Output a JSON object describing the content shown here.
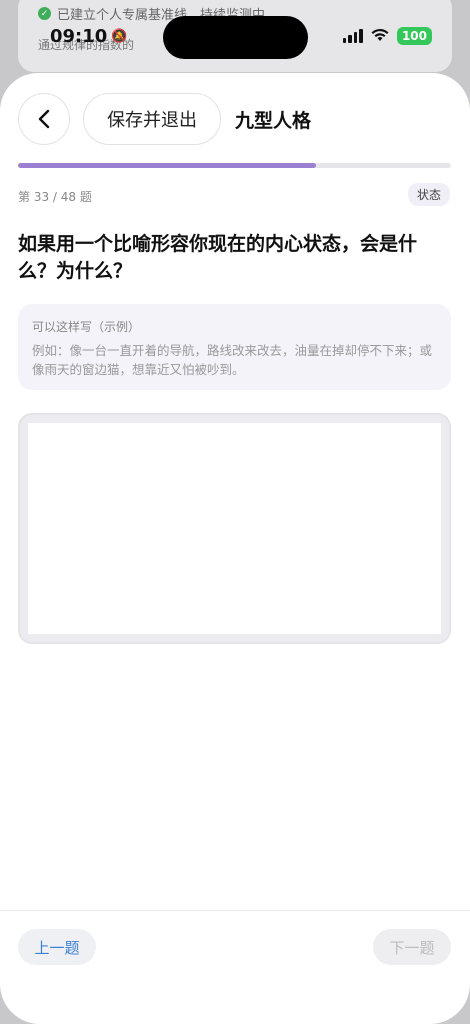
{
  "background_app": {
    "line1": "已建立个人专属基准线，持续监测中",
    "line2": "通过规律的指数的"
  },
  "status_bar": {
    "time": "09:10",
    "battery": "100"
  },
  "header": {
    "save_label": "保存并退出",
    "title": "九型人格"
  },
  "progress": {
    "current": 33,
    "total": 48,
    "counter_text": "第 33 / 48 题",
    "fraction": 0.6875
  },
  "state_badge": "状态",
  "question": "如果用一个比喻形容你现在的内心状态，会是什么？为什么？",
  "example": {
    "title": "可以这样写（示例）",
    "text": "例如：像一台一直开着的导航，路线改来改去，油量在掉却停不下来；或像雨天的窗边猫，想靠近又怕被吵到。"
  },
  "answer": {
    "value": "",
    "placeholder": ""
  },
  "footer": {
    "prev_label": "上一题",
    "next_label": "下一题"
  },
  "colors": {
    "accent": "#9b7fd1",
    "prev_text": "#3c7fd6",
    "battery": "#34c759"
  },
  "icons": [
    "check-icon",
    "silent-bell-icon",
    "signal-icon",
    "wifi-icon",
    "battery-icon",
    "chevron-left-icon"
  ]
}
